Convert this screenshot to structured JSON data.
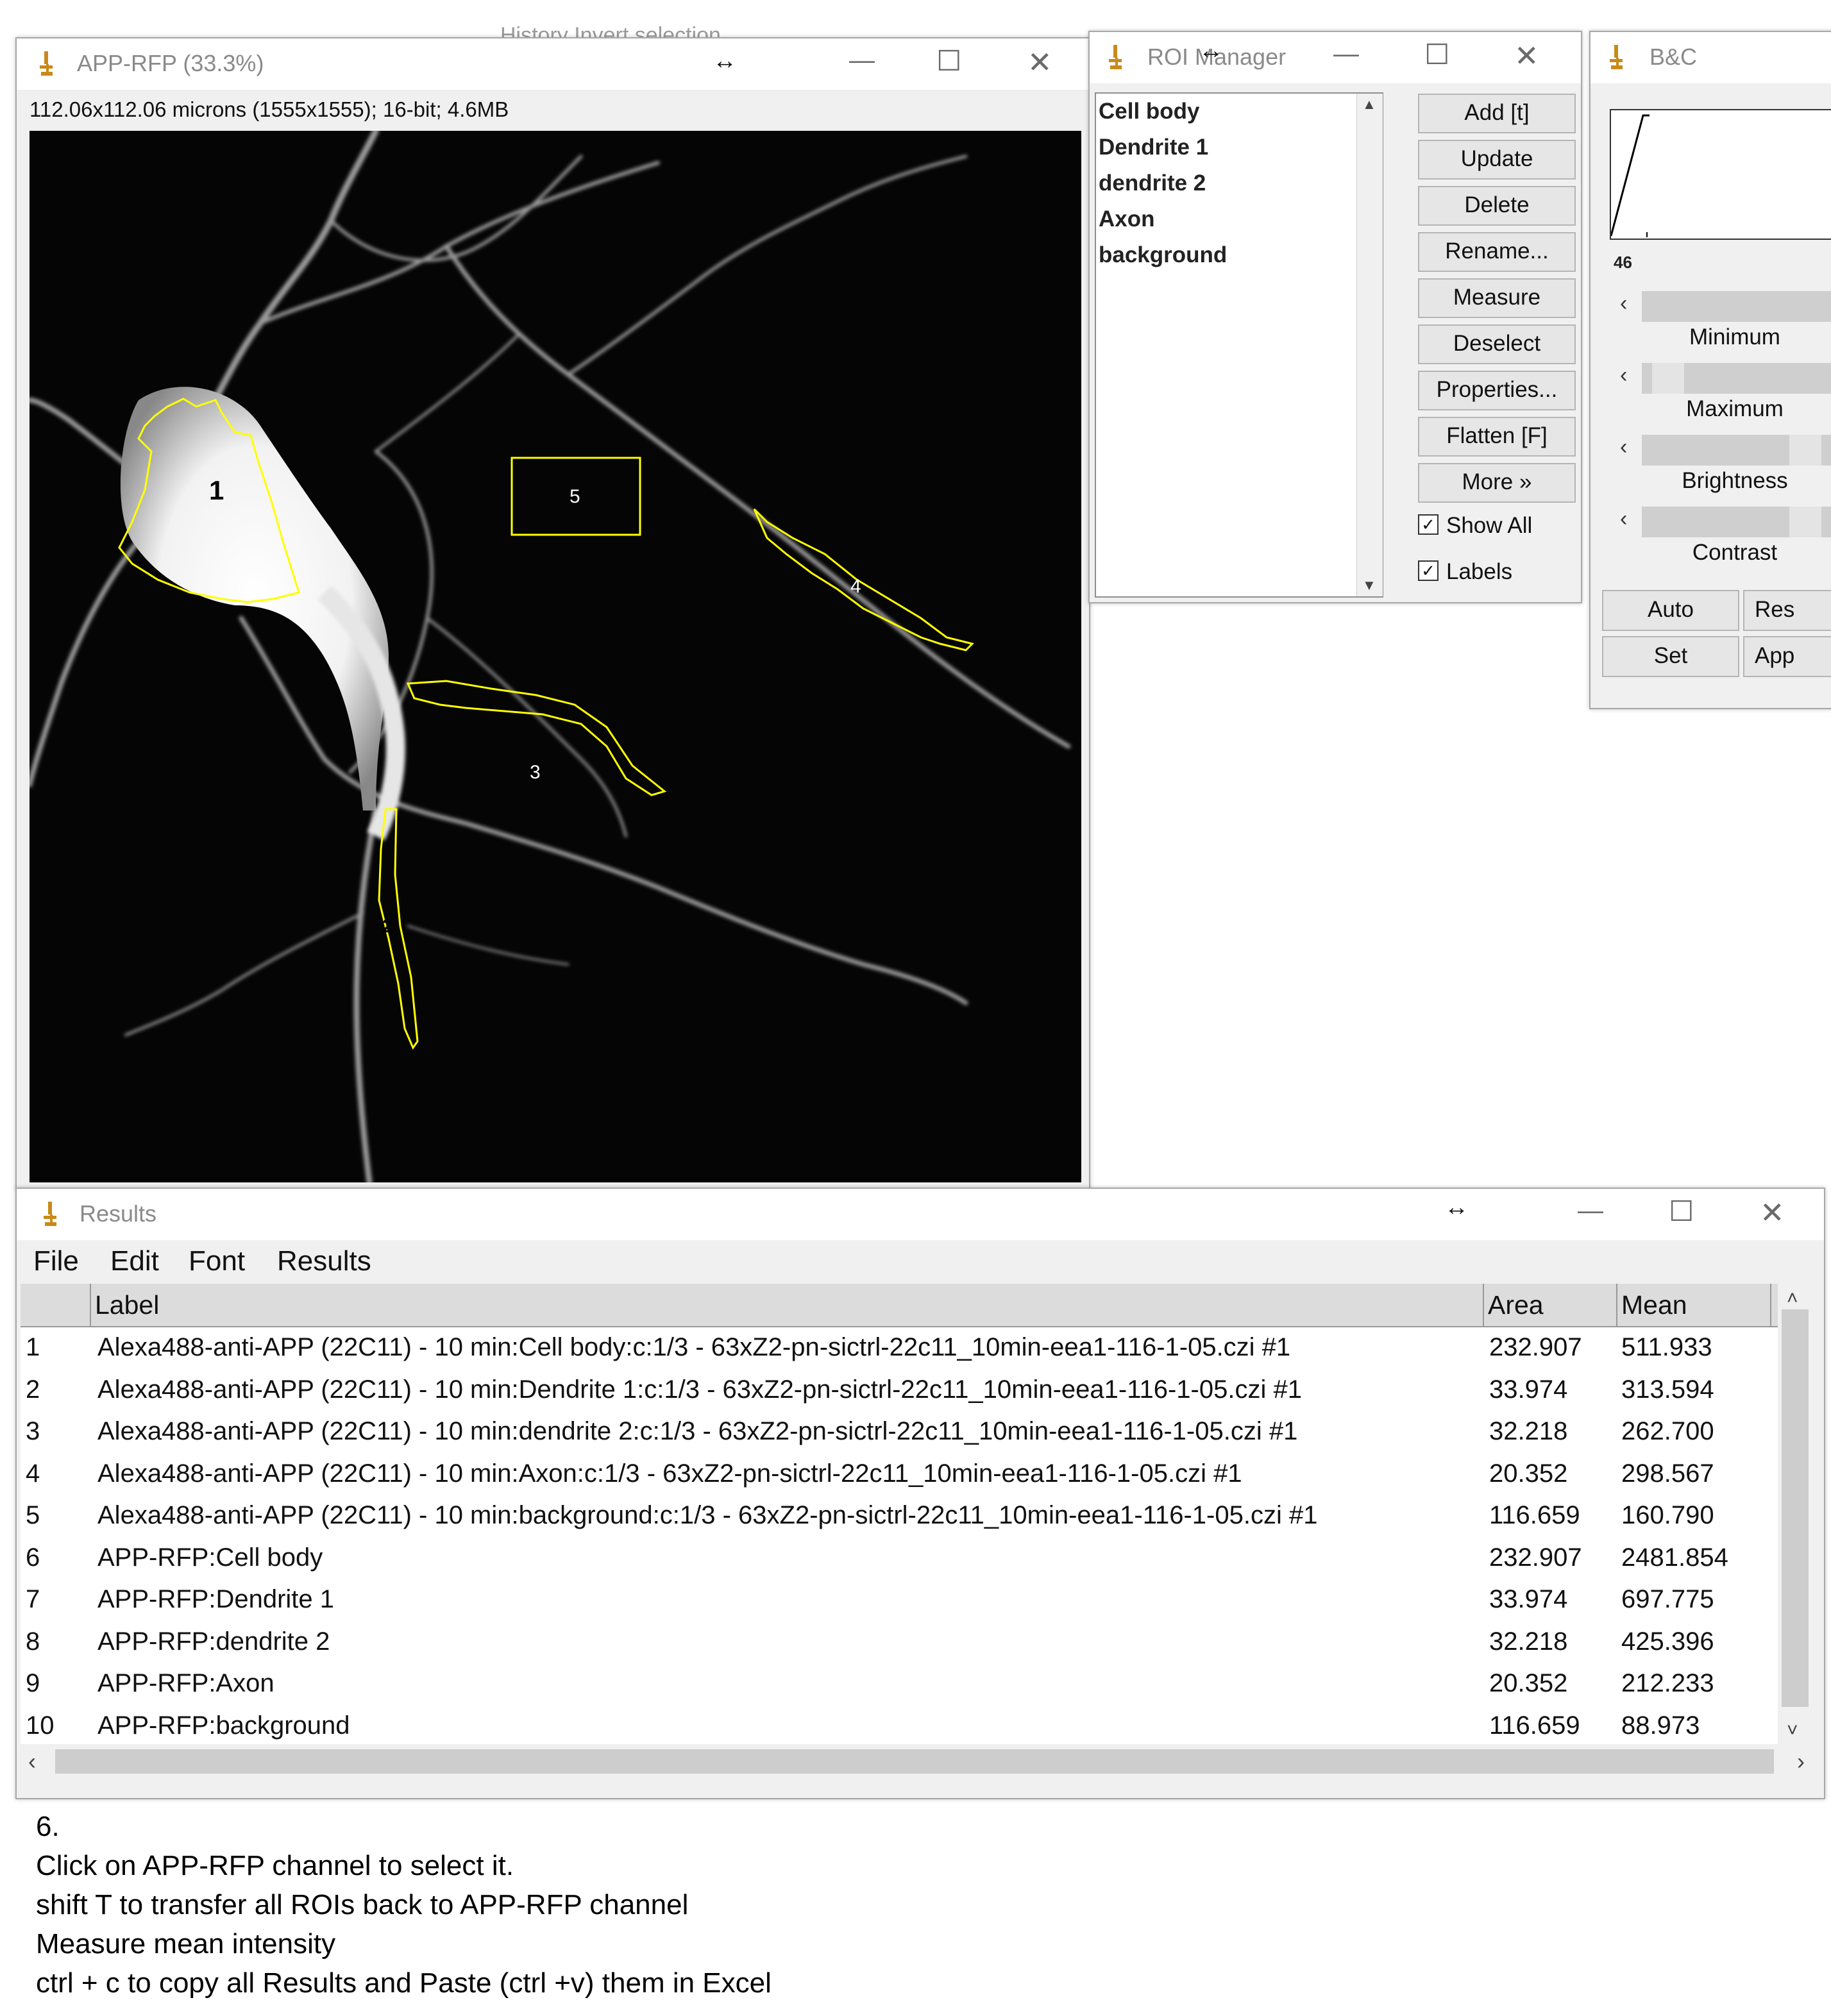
{
  "background_window": {
    "ghost_text": "History   Invert selection"
  },
  "image_window": {
    "title": "APP-RFP (33.3%)",
    "info": "112.06x112.06 microns (1555x1555); 16-bit; 4.6MB",
    "roi_labels": [
      "1",
      "2",
      "3",
      "4",
      "5"
    ]
  },
  "roi_manager": {
    "title": "ROI Manager",
    "items": [
      "Cell body",
      "Dendrite 1",
      "dendrite 2",
      "Axon",
      "background"
    ],
    "buttons": [
      "Add [t]",
      "Update",
      "Delete",
      "Rename...",
      "Measure",
      "Deselect",
      "Properties...",
      "Flatten [F]",
      "More »"
    ],
    "show_all": {
      "label": "Show All",
      "checked": true
    },
    "labels": {
      "label": "Labels",
      "checked": true
    }
  },
  "bc": {
    "title": "B&C",
    "hist_min": "46",
    "sliders": [
      "Minimum",
      "Maximum",
      "Brightness",
      "Contrast"
    ],
    "buttons": [
      "Auto",
      "Res",
      "Set",
      "App"
    ]
  },
  "results": {
    "title": "Results",
    "menu": [
      "File",
      "Edit",
      "Font",
      "Results"
    ],
    "columns": [
      "Label",
      "Area",
      "Mean"
    ],
    "rows": [
      {
        "n": "1",
        "label": "Alexa488-anti-APP (22C11) - 10 min:Cell body:c:1/3 - 63xZ2-pn-sictrl-22c11_10min-eea1-116-1-05.czi #1",
        "area": "232.907",
        "mean": "511.933"
      },
      {
        "n": "2",
        "label": "Alexa488-anti-APP (22C11) - 10 min:Dendrite 1:c:1/3 - 63xZ2-pn-sictrl-22c11_10min-eea1-116-1-05.czi #1",
        "area": "33.974",
        "mean": "313.594"
      },
      {
        "n": "3",
        "label": "Alexa488-anti-APP (22C11) - 10 min:dendrite 2:c:1/3 - 63xZ2-pn-sictrl-22c11_10min-eea1-116-1-05.czi #1",
        "area": "32.218",
        "mean": "262.700"
      },
      {
        "n": "4",
        "label": "Alexa488-anti-APP (22C11) - 10 min:Axon:c:1/3 - 63xZ2-pn-sictrl-22c11_10min-eea1-116-1-05.czi #1",
        "area": "20.352",
        "mean": "298.567"
      },
      {
        "n": "5",
        "label": "Alexa488-anti-APP (22C11) - 10 min:background:c:1/3 - 63xZ2-pn-sictrl-22c11_10min-eea1-116-1-05.czi #1",
        "area": "116.659",
        "mean": "160.790"
      },
      {
        "n": "6",
        "label": "APP-RFP:Cell body",
        "area": "232.907",
        "mean": "2481.854"
      },
      {
        "n": "7",
        "label": "APP-RFP:Dendrite 1",
        "area": "33.974",
        "mean": "697.775"
      },
      {
        "n": "8",
        "label": "APP-RFP:dendrite 2",
        "area": "32.218",
        "mean": "425.396"
      },
      {
        "n": "9",
        "label": "APP-RFP:Axon",
        "area": "20.352",
        "mean": "212.233"
      },
      {
        "n": "10",
        "label": "APP-RFP:background",
        "area": "116.659",
        "mean": "88.973"
      }
    ]
  },
  "instructions": [
    "6.",
    "Click on APP-RFP channel to select it.",
    "shift T to transfer all ROIs back to APP-RFP channel",
    "Measure mean intensity",
    "ctrl + c to copy all Results and Paste (ctrl +v) them in Excel"
  ],
  "colors": {
    "roi": "#ffff00",
    "image_bg": "#050505",
    "window_bg": "#f0f0f0"
  }
}
